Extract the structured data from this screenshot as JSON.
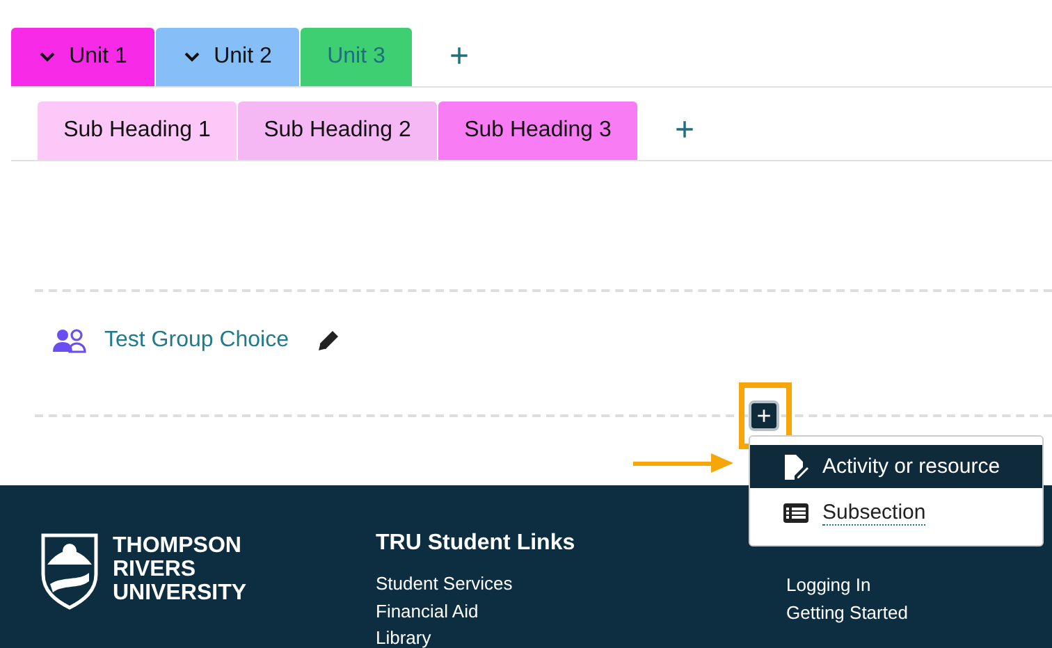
{
  "unit_tabs": [
    {
      "label": "Unit 1",
      "collapsible": true,
      "selected": false,
      "color": "#f72ae8"
    },
    {
      "label": "Unit 2",
      "collapsible": true,
      "selected": false,
      "color": "#86bff7"
    },
    {
      "label": "Unit 3",
      "collapsible": false,
      "selected": true,
      "color": "#3ecf72"
    }
  ],
  "unit_add": "+",
  "sub_tabs": [
    {
      "label": "Sub Heading 1",
      "color": "#fbc8f8"
    },
    {
      "label": "Sub Heading 2",
      "color": "#f5b8f5"
    },
    {
      "label": "Sub Heading 3",
      "color": "#f87cf3"
    }
  ],
  "sub_add": "+",
  "activity": {
    "title": "Test Group Choice"
  },
  "add_button": {
    "label": "+",
    "highlighted": true
  },
  "add_menu": [
    {
      "label": "Activity or resource",
      "kind": "activity",
      "selected": true
    },
    {
      "label": "Subsection",
      "kind": "subsection",
      "selected": false
    }
  ],
  "footer": {
    "logo": [
      "THOMPSON",
      "RIVERS",
      "UNIVERSITY"
    ],
    "columns": [
      {
        "heading": "TRU Student Links",
        "links": [
          "Student Services",
          "Financial Aid",
          "Library"
        ]
      },
      {
        "links": [
          "Logging In",
          "Getting Started"
        ]
      }
    ]
  }
}
